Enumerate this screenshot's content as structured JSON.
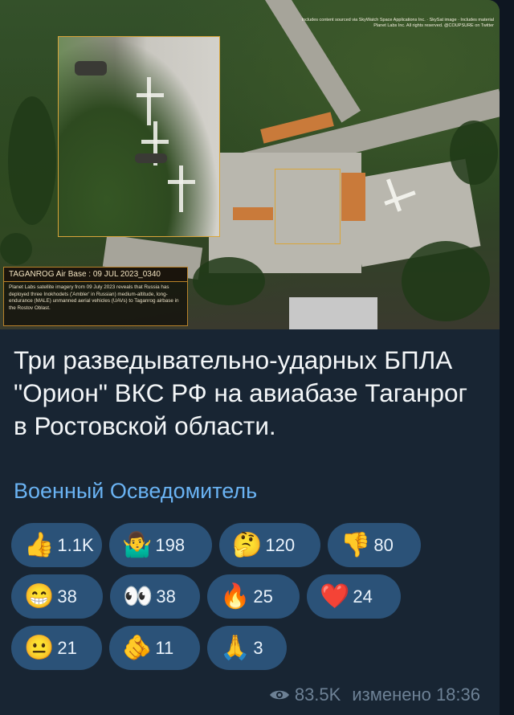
{
  "image": {
    "credit_line": "Includes content sourced via SkyWatch Space Applications Inc. · SkySat image · Includes material Planet Labs Inc. All rights reserved. @COUPSURE on Twitter",
    "caption_title": "TAGANROG Air Base : 09 JUL 2023_0340",
    "caption_text": "Planet Labs satellite imagery from 09 July 2023 reveals that Russia has deployed three Inokhodets ('Ambler' in Russian) medium-altitude, long-endurance (MALE) unmanned aerial vehicles (UAVs) to Taganrog airbase in the Rostov Oblast."
  },
  "post": {
    "text": "Три разведывательно-ударных БПЛА \"Орион\" ВКС РФ на авиабазе Таганрог в Ростовской области.",
    "signature": "Военный Осведомитель"
  },
  "reactions": [
    {
      "emoji": "👍",
      "icon": "thumbs-up-icon",
      "count": "1.1K"
    },
    {
      "emoji": "🤷‍♂️",
      "icon": "shrug-icon",
      "count": "198"
    },
    {
      "emoji": "🤔",
      "icon": "thinking-face-icon",
      "count": "120"
    },
    {
      "emoji": "👎",
      "icon": "thumbs-down-icon",
      "count": "80"
    },
    {
      "emoji": "😁",
      "icon": "grinning-face-icon",
      "count": "38"
    },
    {
      "emoji": "👀",
      "icon": "eyes-icon",
      "count": "38"
    },
    {
      "emoji": "🔥",
      "icon": "fire-icon",
      "count": "25"
    },
    {
      "emoji": "❤️",
      "icon": "red-heart-icon",
      "count": "24"
    },
    {
      "emoji": "😐",
      "icon": "neutral-face-icon",
      "count": "21"
    },
    {
      "emoji": "🫵",
      "icon": "pointing-hand-icon",
      "count": "11"
    },
    {
      "emoji": "🙏",
      "icon": "folded-hands-icon",
      "count": "3"
    }
  ],
  "meta": {
    "views": "83.5K",
    "edited": "изменено 18:36"
  },
  "colors": {
    "background": "#0e1621",
    "bubble": "#182533",
    "reaction_chip": "#2b5278",
    "link": "#6ab3f3",
    "meta": "#6d8195"
  }
}
